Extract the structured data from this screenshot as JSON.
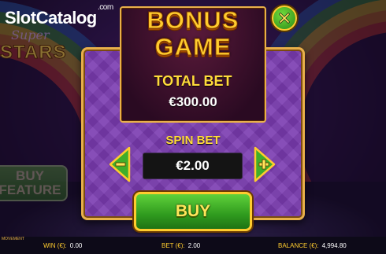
{
  "watermark": {
    "brand_part1": "Slot",
    "brand_part2": "Catalog",
    "brand_suffix": ".com"
  },
  "game_logo": {
    "line1": "Super",
    "line2": "STARS"
  },
  "side": {
    "buy_feature_line1": "BUY",
    "buy_feature_line2": "FEATURE"
  },
  "dialog": {
    "title_line1": "BONUS",
    "title_line2": "GAME",
    "total_bet_label": "TOTAL BET",
    "total_bet_value": "€300.00",
    "spin_bet_label": "SPIN BET",
    "spin_bet_value": "€2.00",
    "decrease_icon": "minus-icon",
    "increase_icon": "plus-icon",
    "close_icon": "close-icon",
    "buy_label": "BUY"
  },
  "status_bar": {
    "mode_label": "MOVEMENT",
    "win_label": "WIN (€):",
    "win_value": "0.00",
    "bet_label": "BET (€):",
    "bet_value": "2.00",
    "balance_label": "BALANCE (€):",
    "balance_value": "4,994.80"
  },
  "colors": {
    "accent_gold": "#ffcc2e",
    "button_green": "#3fae2a",
    "panel_purple": "#7a3bb0"
  }
}
